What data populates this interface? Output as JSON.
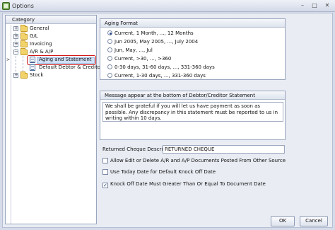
{
  "window": {
    "title": "Options"
  },
  "tree": {
    "header": "Category",
    "items": [
      {
        "label": "General",
        "expander": "+"
      },
      {
        "label": "G/L",
        "expander": "+"
      },
      {
        "label": "Invoicing",
        "expander": "+"
      },
      {
        "label": "A/R & A/P",
        "expander": "−"
      },
      {
        "label": "Aging and Statement"
      },
      {
        "label": "Default Debtor & Creditor"
      },
      {
        "label": "Stock",
        "expander": "+"
      }
    ]
  },
  "aging": {
    "title": "Aging Format",
    "options": [
      "Current, 1 Month, ..., 12 Months",
      "Jun 2005, May 2005, ..., July 2004",
      "Jun, May, ..., Jul",
      "Current, >30, ..., >360",
      "0-30 days, 31-60 days, ..., 331-360 days",
      "Current, 1-30 days, ..., 331-360 days"
    ],
    "selected_index": 0
  },
  "message": {
    "title": "Message appear at the bottom of Debtor/Creditor Statement",
    "text": "We shall be grateful if you will let us have payment as soon as possible. Any discrepancy in this statement must be reported to us in writing within 10 days."
  },
  "returned_cheque": {
    "label": "Returned Cheque Description:",
    "value": "RETURNED CHEQUE"
  },
  "checkboxes": [
    {
      "label": "Allow Edit or Delete A/R and A/P Documents Posted From Other Source",
      "checked": false
    },
    {
      "label": "Use Today Date for Default Knock Off Date",
      "checked": false
    },
    {
      "label": "Knock Off Date Must Greater Than Or Equal To Document Date",
      "checked": true
    }
  ],
  "buttons": {
    "ok": "OK",
    "cancel": "Cancel"
  },
  "icons": {
    "window_icon": "options-app-icon",
    "minimize": "minimize-icon",
    "maximize": "maximize-icon",
    "close": "close-icon"
  },
  "colors": {
    "selection_highlight": "#d01818",
    "selected_row": "#cfe0f6"
  }
}
